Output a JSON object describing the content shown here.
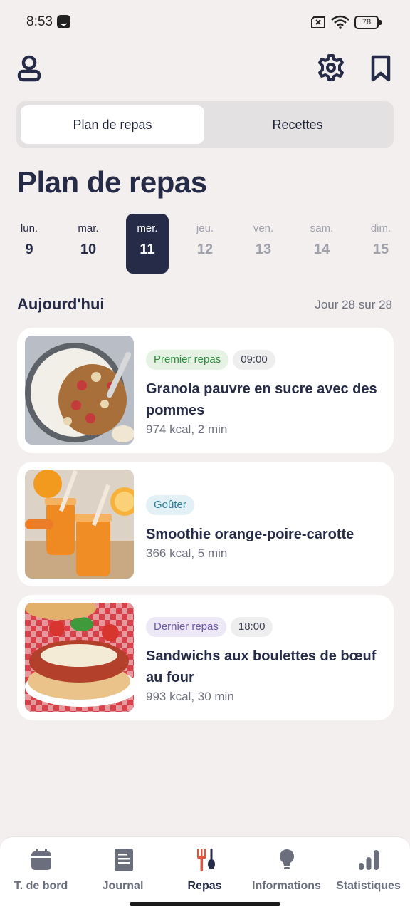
{
  "status_bar": {
    "time": "8:53",
    "battery": "78"
  },
  "tabs": [
    {
      "label": "Plan de repas",
      "active": true
    },
    {
      "label": "Recettes",
      "active": false
    }
  ],
  "page_title": "Plan de repas",
  "week": [
    {
      "name": "lun.",
      "num": "9"
    },
    {
      "name": "mar.",
      "num": "10"
    },
    {
      "name": "mer.",
      "num": "11",
      "selected": true
    },
    {
      "name": "jeu.",
      "num": "12"
    },
    {
      "name": "ven.",
      "num": "13"
    },
    {
      "name": "sam.",
      "num": "14"
    },
    {
      "name": "dim.",
      "num": "15"
    }
  ],
  "section": {
    "title": "Aujourd'hui",
    "progress": "Jour 28 sur 28"
  },
  "meals": [
    {
      "tag": "Premier repas",
      "time": "09:00",
      "title": "Granola pauvre en sucre avec des pommes",
      "meta": "974 kcal, 2 min"
    },
    {
      "tag": "Goûter",
      "title": "Smoothie orange-poire-carotte",
      "meta": "366 kcal, 5 min"
    },
    {
      "tag": "Dernier repas",
      "time": "18:00",
      "title": "Sandwichs aux boulettes de bœuf au four",
      "meta": "993 kcal, 30 min"
    }
  ],
  "nav": [
    {
      "label": "T. de bord",
      "icon": "calendar-icon"
    },
    {
      "label": "Journal",
      "icon": "journal-icon"
    },
    {
      "label": "Repas",
      "icon": "fork-spoon-icon",
      "active": true
    },
    {
      "label": "Informations",
      "icon": "lightbulb-icon"
    },
    {
      "label": "Statistiques",
      "icon": "bar-chart-icon"
    }
  ],
  "colors": {
    "accent_dark": "#262b47",
    "background": "#f3efee",
    "nav_active_icon": "#e2533d"
  }
}
